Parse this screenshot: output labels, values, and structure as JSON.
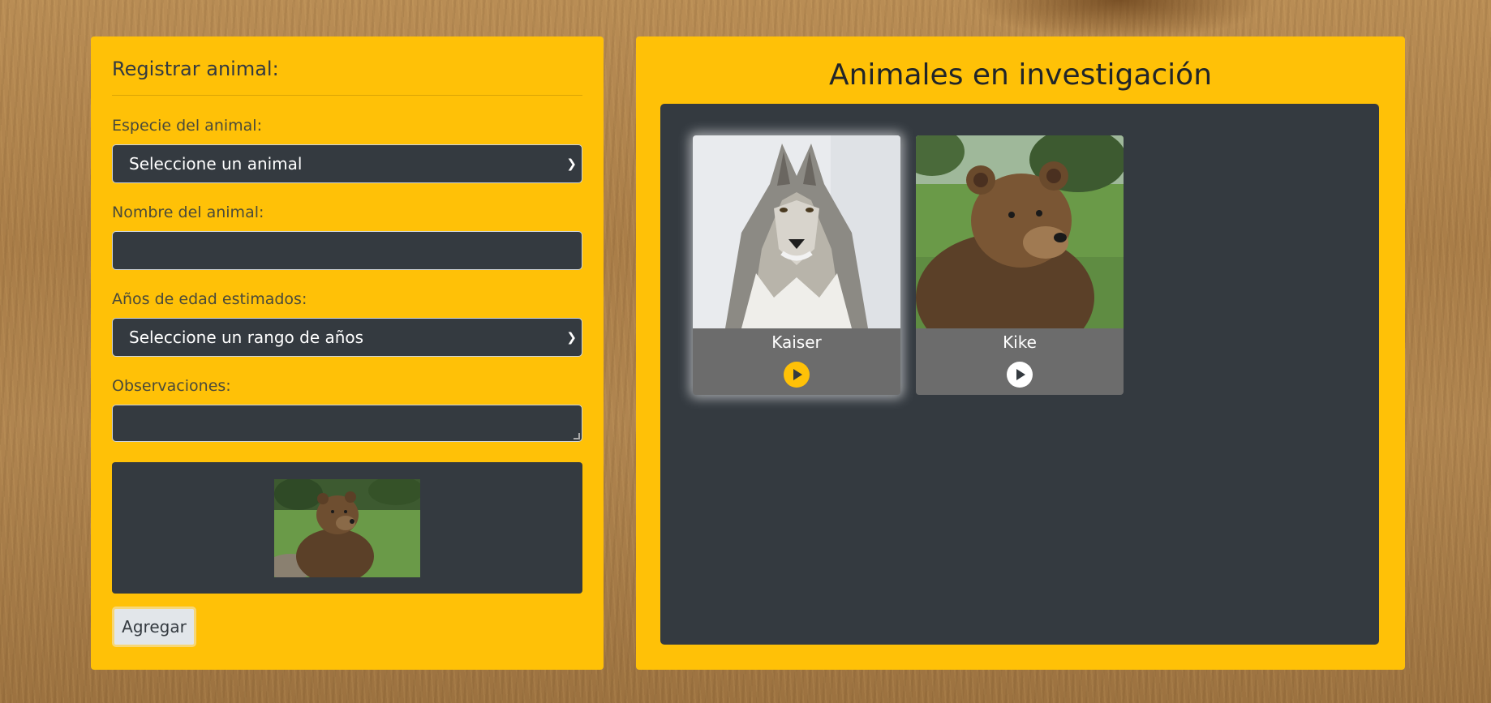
{
  "form": {
    "title": "Registrar animal:",
    "species_label": "Especie del animal:",
    "species_selected": "Seleccione un animal",
    "name_label": "Nombre del animal:",
    "name_value": "",
    "age_label": "Años de edad estimados:",
    "age_selected": "Seleccione un rango de años",
    "notes_label": "Observaciones:",
    "notes_value": "",
    "preview_image": "bear-photo",
    "add_button": "Agregar"
  },
  "gallery": {
    "title": "Animales en investigación",
    "animals": [
      {
        "name": "Kaiser",
        "image": "wolf-photo",
        "selected": true
      },
      {
        "name": "Kike",
        "image": "bear-photo",
        "selected": false
      }
    ]
  },
  "colors": {
    "panel": "#ffc107",
    "dark": "#343a40",
    "card": "#6c6c6c",
    "play_active": "#ffc107",
    "play_idle": "#ffffff"
  }
}
